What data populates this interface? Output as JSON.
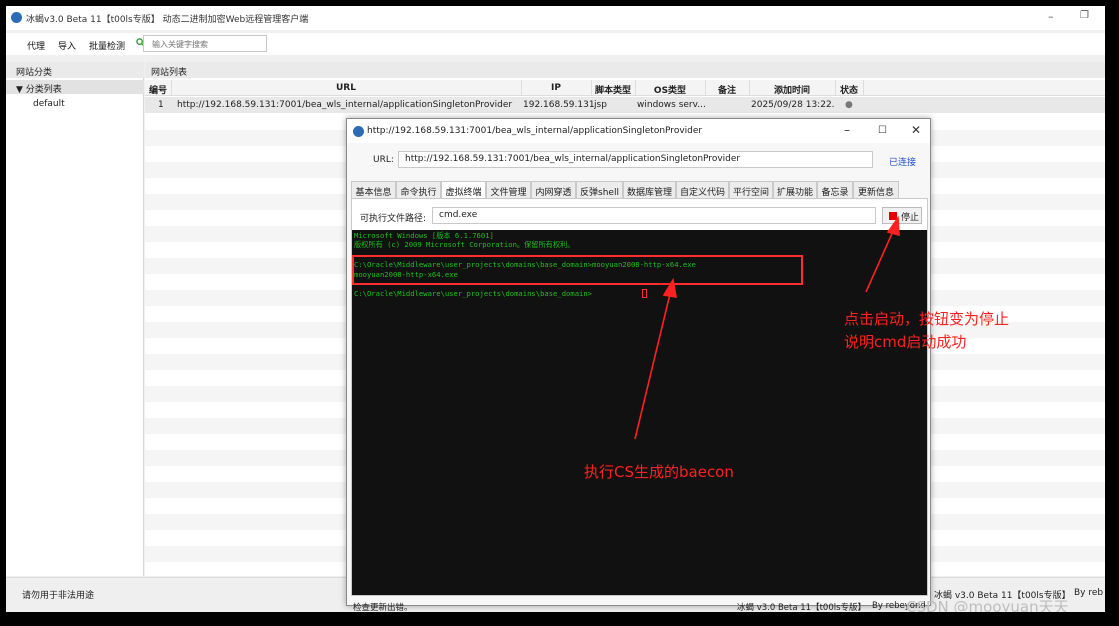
{
  "window": {
    "title": "冰蝎v3.0 Beta 11【t00ls专版】 动态二进制加密Web远程管理客户端",
    "minimize_icon": "minimize-icon",
    "restore_icon": "restore-icon"
  },
  "toolbar": {
    "proxy": "代理",
    "import": "导入",
    "batch_check": "批量检测",
    "search_placeholder": "输入关键字搜索"
  },
  "left_panel": {
    "header": "网站分类",
    "node": "▼  分类列表",
    "leaf": "default"
  },
  "right_panel": {
    "header": "网站列表",
    "columns": [
      "编号",
      "URL",
      "IP",
      "脚本类型",
      "OS类型",
      "备注",
      "添加时间",
      "状态"
    ],
    "rows": [
      {
        "id": "1",
        "url": "http://192.168.59.131:7001/bea_wls_internal/applicationSingletonProvider",
        "ip": "192.168.59.131",
        "script_type": "jsp",
        "os": "windows serv...",
        "note": "",
        "added": "2025/09/28 13:22...",
        "status": "●"
      }
    ]
  },
  "status_bar": {
    "left": "请勿用于非法用途",
    "version": "冰蝎 v3.0 Beta 11【t00ls专版】",
    "by": "By reb"
  },
  "dialog": {
    "title": "http://192.168.59.131:7001/bea_wls_internal/applicationSingletonProvider",
    "url_label": "URL:",
    "url_value": "http://192.168.59.131:7001/bea_wls_internal/applicationSingletonProvider",
    "connected": "已连接",
    "tabs": [
      "基本信息",
      "命令执行",
      "虚拟终端",
      "文件管理",
      "内网穿透",
      "反弹shell",
      "数据库管理",
      "自定义代码",
      "平行空间",
      "扩展功能",
      "备忘录",
      "更新信息"
    ],
    "active_tab": "虚拟终端",
    "path_label": "可执行文件路径:",
    "path_value": "cmd.exe",
    "stop_button": "停止",
    "terminal": [
      "Microsoft Windows [版本 6.1.7601]",
      "版权所有 (c) 2009 Microsoft Corporation。保留所有权利。",
      "",
      "C:\\Oracle\\Middleware\\user_projects\\domains\\base_domain>mooyuan2008-http-x64.exe",
      "mooyuan2008-http-x64.exe",
      "",
      "C:\\Oracle\\Middleware\\user_projects\\domains\\base_domain>"
    ],
    "status_left": "检查更新出错。",
    "status_version": "冰蝎 v3.0 Beta 11【t00ls专版】",
    "status_by": "By rebeyond"
  },
  "annotations": {
    "note1_line1": "点击启动，按钮变为停止",
    "note1_line2": "说明cmd启动成功",
    "note2": "执行CS生成的baecon",
    "color": "#ff2020"
  },
  "watermark": "CSDN @mooyuan天天"
}
